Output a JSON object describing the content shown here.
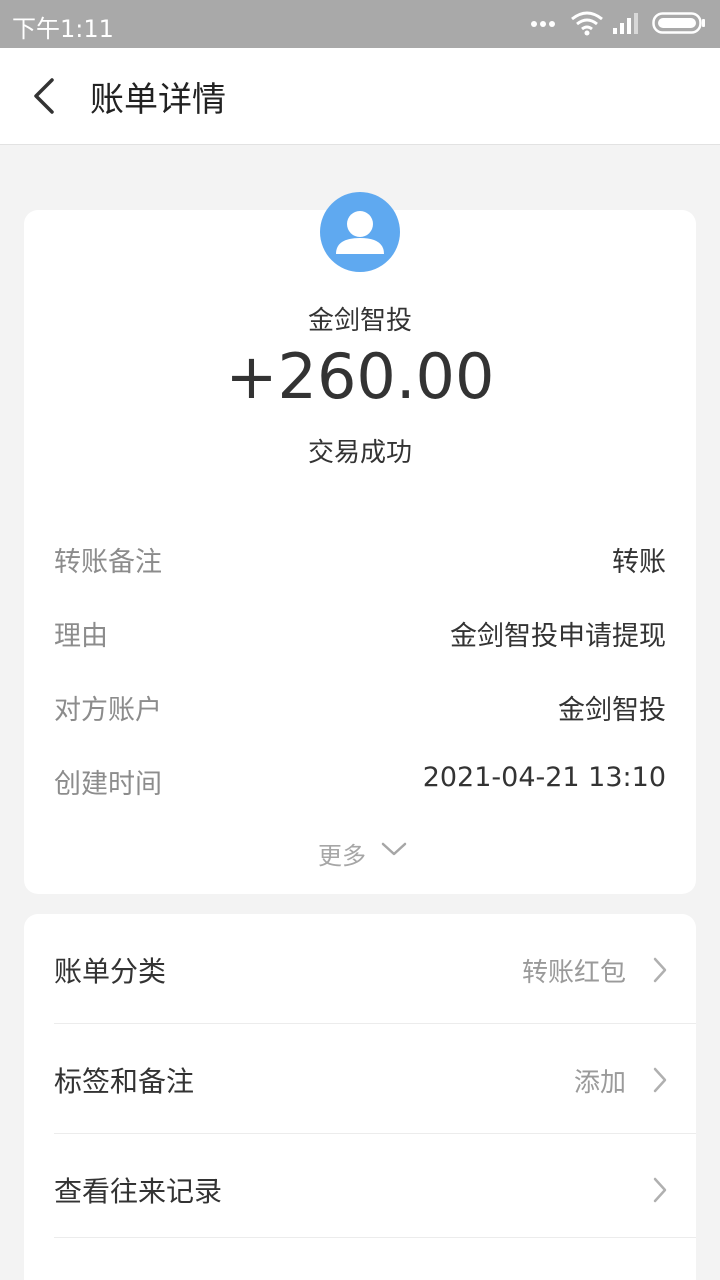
{
  "status_bar": {
    "time": "下午1:11"
  },
  "nav": {
    "title": "账单详情"
  },
  "transaction": {
    "payer_name": "金剑智投",
    "amount": "+260.00",
    "status": "交易成功"
  },
  "details": [
    {
      "label": "转账备注",
      "value": "转账"
    },
    {
      "label": "理由",
      "value": "金剑智投申请提现"
    },
    {
      "label": "对方账户",
      "value": "金剑智投"
    },
    {
      "label": "创建时间",
      "value": "2021-04-21 13:10"
    }
  ],
  "more": {
    "label": "更多"
  },
  "actions": [
    {
      "label": "账单分类",
      "value": "转账红包"
    },
    {
      "label": "标签和备注",
      "value": "添加"
    },
    {
      "label": "查看往来记录",
      "value": ""
    }
  ],
  "colors": {
    "avatar": "#5fa9f0",
    "status_bar": "#a9a9a9"
  }
}
